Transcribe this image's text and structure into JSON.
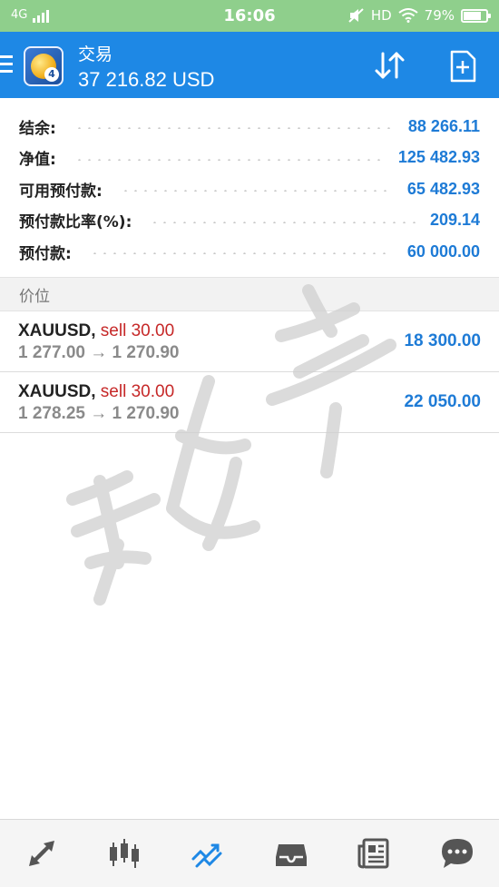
{
  "status_bar": {
    "network": "4G",
    "time": "16:06",
    "hd": "HD",
    "battery": "79%",
    "battery_level": 0.79
  },
  "app_bar": {
    "title": "交易",
    "balance_display": "37 216.82 USD"
  },
  "account": {
    "rows": [
      {
        "label": "结余:",
        "value": "88 266.11"
      },
      {
        "label": "净值:",
        "value": "125 482.93"
      },
      {
        "label": "可用预付款:",
        "value": "65 482.93"
      },
      {
        "label": "预付款比率(%):",
        "value": "209.14"
      },
      {
        "label": "预付款:",
        "value": "60 000.00"
      }
    ]
  },
  "positions": {
    "header": "价位",
    "items": [
      {
        "symbol": "XAUUSD,",
        "side": "sell 30.00",
        "prices": "1 277.00 → 1 270.90",
        "profit": "18 300.00"
      },
      {
        "symbol": "XAUUSD,",
        "side": "sell 30.00",
        "prices": "1 278.25 → 1 270.90",
        "profit": "22 050.00"
      }
    ]
  },
  "bottom_nav": {
    "items": [
      {
        "icon": "quotes-arrows-icon"
      },
      {
        "icon": "candlestick-chart-icon"
      },
      {
        "icon": "trade-trend-icon",
        "active": true
      },
      {
        "icon": "inbox-history-icon"
      },
      {
        "icon": "news-icon"
      },
      {
        "icon": "chat-icon"
      }
    ]
  },
  "colors": {
    "status_bar": "#8fcf8c",
    "app_bar": "#1e88e5",
    "value_blue": "#1e7bd6",
    "sell_red": "#c62828",
    "nav_active": "#1e88e5",
    "nav_inactive": "#555555"
  }
}
